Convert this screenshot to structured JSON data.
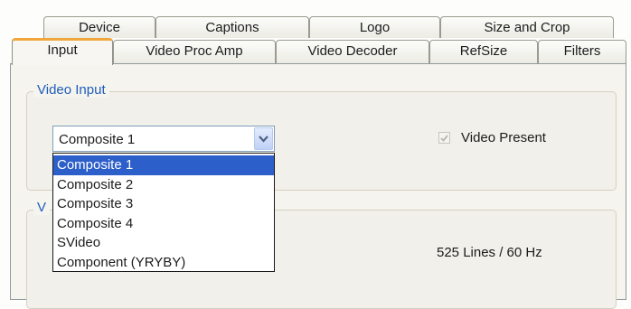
{
  "tabs_row1": [
    "Device",
    "Captions",
    "Logo",
    "Size and Crop"
  ],
  "tabs_row2": [
    "Input",
    "Video Proc Amp",
    "Video Decoder",
    "RefSize",
    "Filters"
  ],
  "active_tab": "Input",
  "video_input": {
    "group_label": "Video Input",
    "selected": "Composite 1",
    "options": [
      "Composite 1",
      "Composite 2",
      "Composite 3",
      "Composite 4",
      "SVideo",
      "Component (YRYBY)"
    ],
    "video_present_label": "Video Present",
    "video_present_checked": true
  },
  "video_standard": {
    "group_label_partial": "V",
    "lines_text": "525 Lines / 60 Hz"
  }
}
